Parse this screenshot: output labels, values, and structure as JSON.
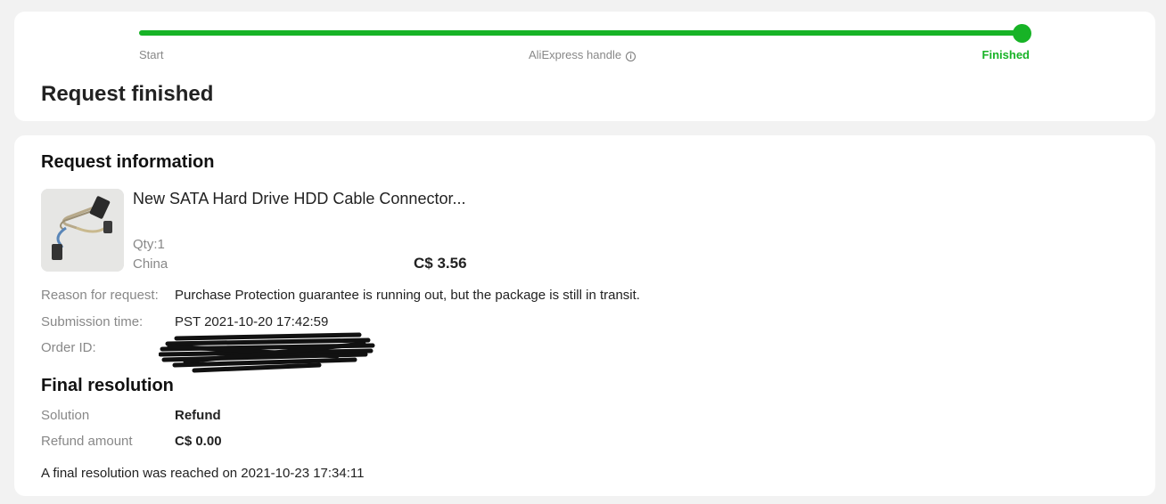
{
  "progress": {
    "value": 1.0,
    "steps": [
      {
        "label": "Start"
      },
      {
        "label": "AliExpress handle",
        "icon": "info-icon"
      },
      {
        "label": "Finished",
        "active": true
      }
    ],
    "accent_color": "#17b326"
  },
  "status": {
    "title": "Request finished"
  },
  "request_info": {
    "title": "Request information",
    "product": {
      "name": "New SATA Hard Drive HDD Cable Connector...",
      "qty": "Qty:1",
      "origin": "China",
      "price": "C$ 3.56",
      "image_icon": "sata-cable-thumbnail"
    },
    "rows": [
      {
        "label": "Reason for request:",
        "value": "Purchase Protection guarantee is running out, but the package is still in transit."
      },
      {
        "label": "Submission time:",
        "value": "PST 2021-10-20 17:42:59"
      },
      {
        "label": "Order ID:",
        "value": ""
      }
    ]
  },
  "final_resolution": {
    "title": "Final resolution",
    "rows": [
      {
        "label": "Solution",
        "value": "Refund"
      },
      {
        "label": "Refund amount",
        "value": "C$ 0.00"
      }
    ],
    "note": "A final resolution was reached on 2021-10-23 17:34:11"
  }
}
